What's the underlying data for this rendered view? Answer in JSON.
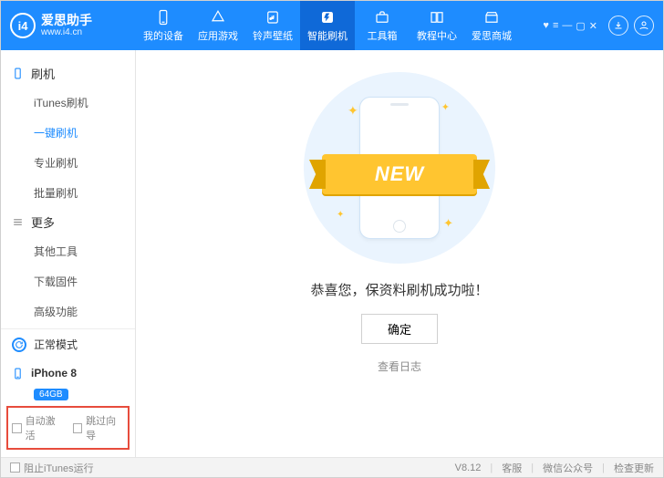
{
  "brand": {
    "title": "爱思助手",
    "url": "www.i4.cn",
    "logo_text": "i4"
  },
  "tabs": [
    {
      "label": "我的设备"
    },
    {
      "label": "应用游戏"
    },
    {
      "label": "铃声壁纸"
    },
    {
      "label": "智能刷机",
      "active": true
    },
    {
      "label": "工具箱"
    },
    {
      "label": "教程中心"
    },
    {
      "label": "爱思商城"
    }
  ],
  "sidebar": {
    "cat1": {
      "label": "刷机"
    },
    "items1": [
      {
        "label": "iTunes刷机"
      },
      {
        "label": "一键刷机",
        "active": true
      },
      {
        "label": "专业刷机"
      },
      {
        "label": "批量刷机"
      }
    ],
    "cat2": {
      "label": "更多"
    },
    "items2": [
      {
        "label": "其他工具"
      },
      {
        "label": "下载固件"
      },
      {
        "label": "高级功能"
      }
    ],
    "mode": "正常模式",
    "device": {
      "name": "iPhone 8",
      "storage": "64GB"
    },
    "options": {
      "auto_activate": "自动激活",
      "skip_guide": "跳过向导"
    }
  },
  "main": {
    "ribbon_text": "NEW",
    "message": "恭喜您，保资料刷机成功啦！",
    "ok": "确定",
    "view_log": "查看日志"
  },
  "footer": {
    "block_itunes": "阻止iTunes运行",
    "version": "V8.12",
    "support": "客服",
    "wechat": "微信公众号",
    "update": "检查更新"
  }
}
